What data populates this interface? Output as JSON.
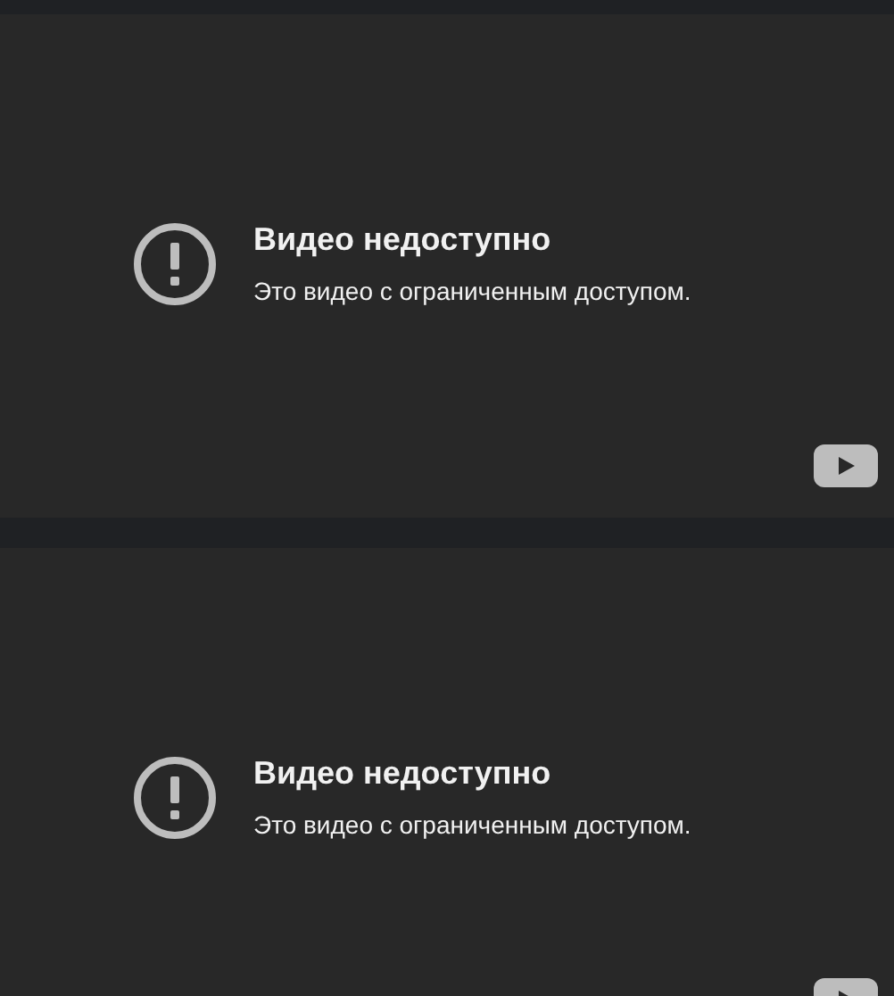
{
  "players": [
    {
      "title": "Видео недоступно",
      "message": "Это видео с ограниченным доступом."
    },
    {
      "title": "Видео недоступно",
      "message": "Это видео с ограниченным доступом."
    }
  ]
}
